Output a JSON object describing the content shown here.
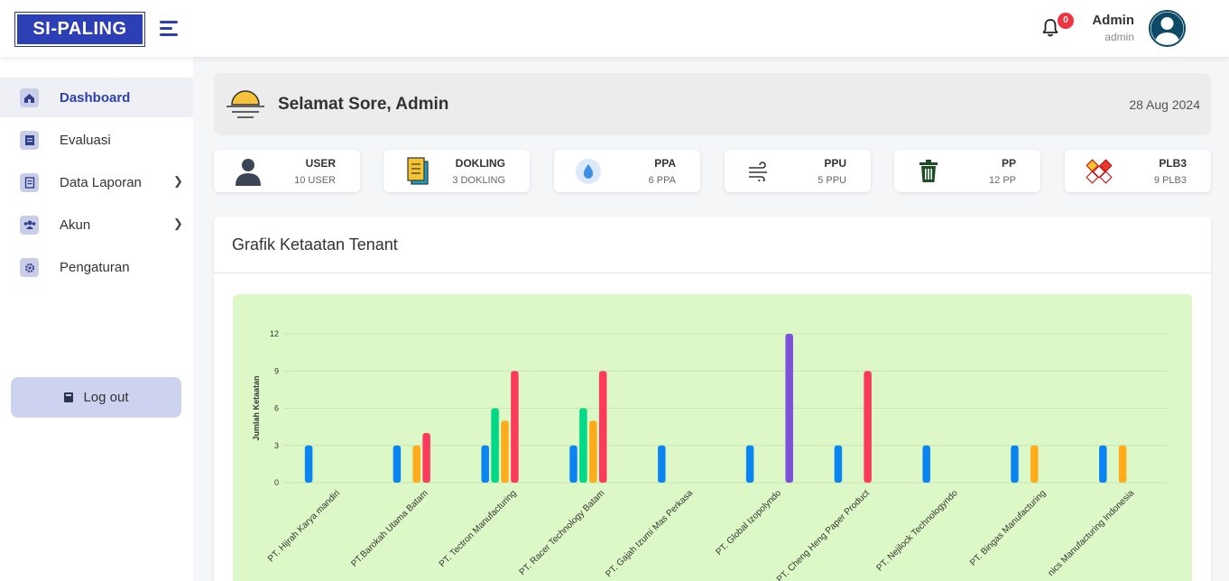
{
  "header": {
    "logo_text": "SI-PALING",
    "notification_count": "0",
    "user_name": "Admin",
    "user_role": "admin"
  },
  "sidebar": {
    "items": [
      {
        "label": "Dashboard",
        "icon": "house-icon",
        "active": true,
        "has_submenu": false
      },
      {
        "label": "Evaluasi",
        "icon": "document-icon",
        "active": false,
        "has_submenu": false
      },
      {
        "label": "Data Laporan",
        "icon": "report-icon",
        "active": false,
        "has_submenu": true
      },
      {
        "label": "Akun",
        "icon": "users-icon",
        "active": false,
        "has_submenu": true
      },
      {
        "label": "Pengaturan",
        "icon": "gear-icon",
        "active": false,
        "has_submenu": false
      }
    ],
    "logout_label": "Log out"
  },
  "greeting": {
    "text": "Selamat Sore, Admin",
    "date": "28 Aug 2024"
  },
  "stats": [
    {
      "title": "USER",
      "sub": "10 USER",
      "icon": "user-icon"
    },
    {
      "title": "DOKLING",
      "sub": "3 DOKLING",
      "icon": "documents-icon"
    },
    {
      "title": "PPA",
      "sub": "6 PPA",
      "icon": "water-drop-icon"
    },
    {
      "title": "PPU",
      "sub": "5 PPU",
      "icon": "wind-icon"
    },
    {
      "title": "PP",
      "sub": "12 PP",
      "icon": "trash-icon"
    },
    {
      "title": "PLB3",
      "sub": "9 PLB3",
      "icon": "hazard-icon"
    }
  ],
  "chart": {
    "title": "Grafik Ketaatan Tenant"
  },
  "colors": {
    "brand": "#2d3fb5",
    "chart_bg": "#dcf8c6",
    "series": [
      "#0b84f3",
      "#00d987",
      "#ffab1a",
      "#fb3a5c",
      "#7b52d9"
    ]
  },
  "chart_data": {
    "type": "bar",
    "title": "",
    "xlabel": "",
    "ylabel": "Jumlah Ketaatan",
    "ylim": [
      0,
      12
    ],
    "yticks": [
      0,
      3,
      6,
      9,
      12
    ],
    "grid": true,
    "categories": [
      "PT. Hijrah Karya mandiri",
      "PT.Barokah Utama Batam",
      "PT. Tectron Manufacturing",
      "PT. Racer Technology Batam",
      "PT. Gajah Izumi Mas Perkasa",
      "PT. Global Izopolyndo",
      "PT. Cheng Heng Paper Product",
      "PT. Nejilock Technologyndo",
      "PT. Bingas Manufacturing",
      "nics Manufacturing Indonesia"
    ],
    "series": [
      {
        "values": [
          3,
          3,
          3,
          3,
          3,
          3,
          3,
          3,
          3,
          3
        ]
      },
      {
        "values": [
          0,
          0,
          6,
          6,
          0,
          0,
          0,
          0,
          0,
          0
        ]
      },
      {
        "values": [
          0,
          3,
          5,
          5,
          0,
          0,
          0,
          0,
          3,
          3
        ]
      },
      {
        "values": [
          0,
          4,
          9,
          9,
          0,
          0,
          9,
          0,
          0,
          0
        ]
      },
      {
        "values": [
          0,
          0,
          0,
          0,
          0,
          12,
          0,
          0,
          0,
          0
        ]
      }
    ]
  }
}
